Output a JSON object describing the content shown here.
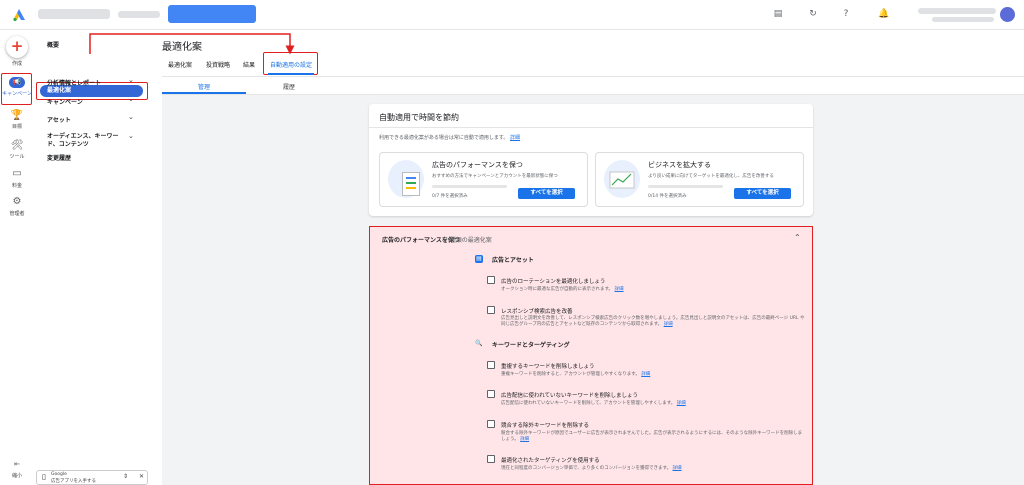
{
  "rail": {
    "create_label": "作成",
    "campaign_label": "キャンペーン",
    "goals_label": "目標",
    "tools_label": "ツール",
    "billing_label": "料金",
    "admin_label": "管理者",
    "collapse_label": "縮小"
  },
  "nav": {
    "overview": "概要",
    "optimization": "最適化案",
    "insights": "分析情報とレポート",
    "campaigns": "キャンペーン",
    "assets": "アセット",
    "audiences_line1": "オーディエンス、キーワー",
    "audiences_line2": "ド、コンテンツ",
    "change_history": "変更履歴"
  },
  "promo": {
    "line1": "Google",
    "line2": "広告アプリを入手する"
  },
  "header": {
    "title": "最適化案",
    "subtabs": [
      "最適化案",
      "投資戦略",
      "結果",
      "自動適用の設定"
    ],
    "tabs": [
      "管理",
      "履歴"
    ]
  },
  "card1": {
    "title": "自動適用で時間を節約",
    "desc": "利用できる最適化案がある場合は常に自動で適用します。",
    "link": "詳細",
    "performance": {
      "title": "広告のパフォーマンスを保つ",
      "desc": "おすすめの方法でキャンペーンとアカウントを最新状態に保つ",
      "count": "0/7 件を選択済み",
      "button": "すべてを選択"
    },
    "growth": {
      "title": "ビジネスを拡大する",
      "desc": "より良い成果に向けてターゲットを最適化し、広告を改善する",
      "count": "0/14 件を選択済み",
      "button": "すべてを選択"
    }
  },
  "card2": {
    "head": "広告のパフォーマンスを保つ",
    "count": "7 種類の最適化案",
    "sections": [
      {
        "title": "広告とアセット",
        "items": [
          {
            "title": "広告のローテーションを最適化しましょう",
            "desc": "オークション時に最適な広告が自動的に表示されます。",
            "link": "詳細"
          },
          {
            "title": "レスポンシブ検索広告を改善",
            "desc": "広告見出しと説明文を改善して、レスポンシブ検索広告のクリック数を増やしましょう。広告見出しと説明文のアセットは、広告の最終ページ URL や同じ広告グループ内の広告とアセットなど既存のコンテンツから取得されます。",
            "link": "詳細"
          }
        ]
      },
      {
        "title": "キーワードとターゲティング",
        "items": [
          {
            "title": "重複するキーワードを削除しましょう",
            "desc": "重複キーワードを削除すると、アカウントが管理しやすくなります。",
            "link": "詳細"
          },
          {
            "title": "広告配信に使われていないキーワードを削除しましょう",
            "desc": "広告配信に使われていないキーワードを削除して、アカウントを管理しやすくします。",
            "link": "詳細"
          },
          {
            "title": "競合する除外キーワードを削除する",
            "desc": "競合する除外キーワードが原因でユーザーに広告が表示されませんでした。広告が表示されるようにするには、そのような除外キーワードを削除しましょう。",
            "link": "詳細"
          },
          {
            "title": "最適化されたターゲティングを使用する",
            "desc": "現在と同程度のコンバージョン単価で、より多くのコンバージョンを獲得できます。",
            "link": "詳細"
          }
        ]
      }
    ]
  },
  "colors": {
    "accent": "#1a73e8",
    "highlight_border": "#e02020",
    "highlight_bg": "#ffe5e8"
  }
}
